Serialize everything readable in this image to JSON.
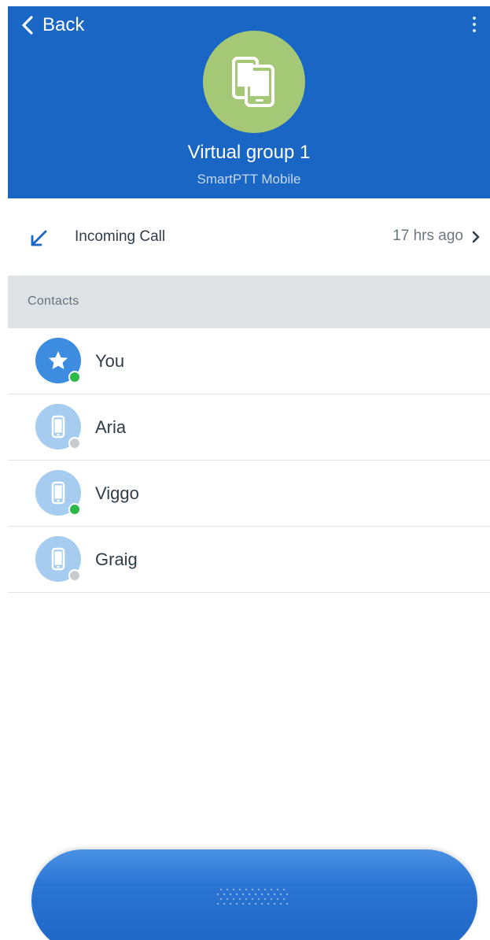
{
  "header": {
    "back_label": "Back",
    "title": "Virtual group 1",
    "subtitle": "SmartPTT Mobile",
    "avatar_icon": "devices-icon",
    "background_color": "#1a66c4",
    "avatar_color": "#a4c875"
  },
  "call": {
    "label": "Incoming Call",
    "time": "17 hrs ago",
    "icon": "incoming-call-arrow-icon"
  },
  "contacts_section": {
    "label": "Contacts"
  },
  "contacts": [
    {
      "name": "You",
      "icon": "star-icon",
      "status": "online"
    },
    {
      "name": "Aria",
      "icon": "phone-icon",
      "status": "offline"
    },
    {
      "name": "Viggo",
      "icon": "phone-icon",
      "status": "online"
    },
    {
      "name": "Graig",
      "icon": "phone-icon",
      "status": "offline"
    }
  ],
  "colors": {
    "accent": "#1a66c4",
    "online": "#2db84a",
    "offline": "#c9ccce"
  },
  "ptt_button": {
    "icon": "speaker-grille-icon"
  }
}
